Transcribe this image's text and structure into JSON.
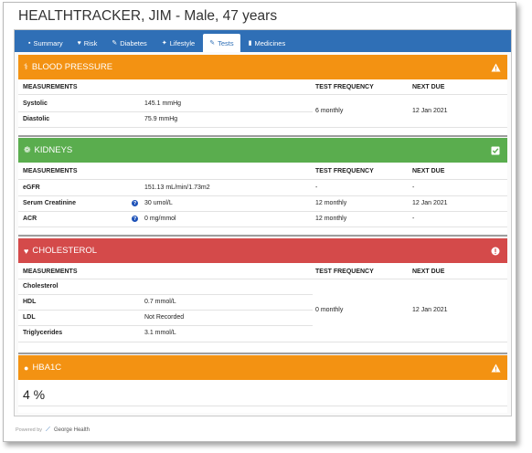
{
  "page": {
    "title": "HEALTHTRACKER, JIM - Male, 47 years"
  },
  "tabs": [
    {
      "label": "Summary",
      "icon": "summary-icon",
      "glyph": "▪"
    },
    {
      "label": "Risk",
      "icon": "heart-icon",
      "glyph": "♥"
    },
    {
      "label": "Diabetes",
      "icon": "syringe-icon",
      "glyph": "✎"
    },
    {
      "label": "Lifestyle",
      "icon": "running-icon",
      "glyph": "✦"
    },
    {
      "label": "Tests",
      "icon": "test-icon",
      "glyph": "✎"
    },
    {
      "label": "Medicines",
      "icon": "medicine-icon",
      "glyph": "▮"
    }
  ],
  "active_tab": "Tests",
  "columns": {
    "measurements": "MEASUREMENTS",
    "frequency": "TEST FREQUENCY",
    "next_due": "NEXT DUE"
  },
  "sections": {
    "blood_pressure": {
      "title": "BLOOD PRESSURE",
      "status": "warning",
      "color": "#f39212",
      "rows": [
        {
          "name": "Systolic",
          "value": "145.1 mmHg"
        },
        {
          "name": "Diastolic",
          "value": "75.9 mmHg"
        }
      ],
      "frequency": "6 monthly",
      "next_due": "12 Jan 2021"
    },
    "kidneys": {
      "title": "KIDNEYS",
      "status": "ok",
      "color": "#5aad4e",
      "rows": [
        {
          "name": "eGFR",
          "value": "151.13 mL/min/1.73m2",
          "frequency": "-",
          "next_due": "-"
        },
        {
          "name": "Serum Creatinine",
          "value": "30 umol/L",
          "frequency": "12 monthly",
          "next_due": "12 Jan 2021"
        },
        {
          "name": "ACR",
          "value": "0 mg/mmol",
          "frequency": "12 monthly",
          "next_due": "-"
        }
      ]
    },
    "cholesterol": {
      "title": "CHOLESTEROL",
      "status": "alert",
      "color": "#d44a4a",
      "rows": [
        {
          "name": "Cholesterol",
          "value": ""
        },
        {
          "name": "HDL",
          "value": "0.7 mmol/L"
        },
        {
          "name": "LDL",
          "value": "Not Recorded"
        },
        {
          "name": "Triglycerides",
          "value": "3.1 mmol/L"
        }
      ],
      "frequency": "0 monthly",
      "next_due": "12 Jan 2021"
    },
    "hba1c": {
      "title": "HBA1C",
      "status": "warning",
      "color": "#f39212",
      "value": "4 %"
    }
  },
  "footer": {
    "powered_by": "Powered by",
    "brand": "George Health"
  }
}
